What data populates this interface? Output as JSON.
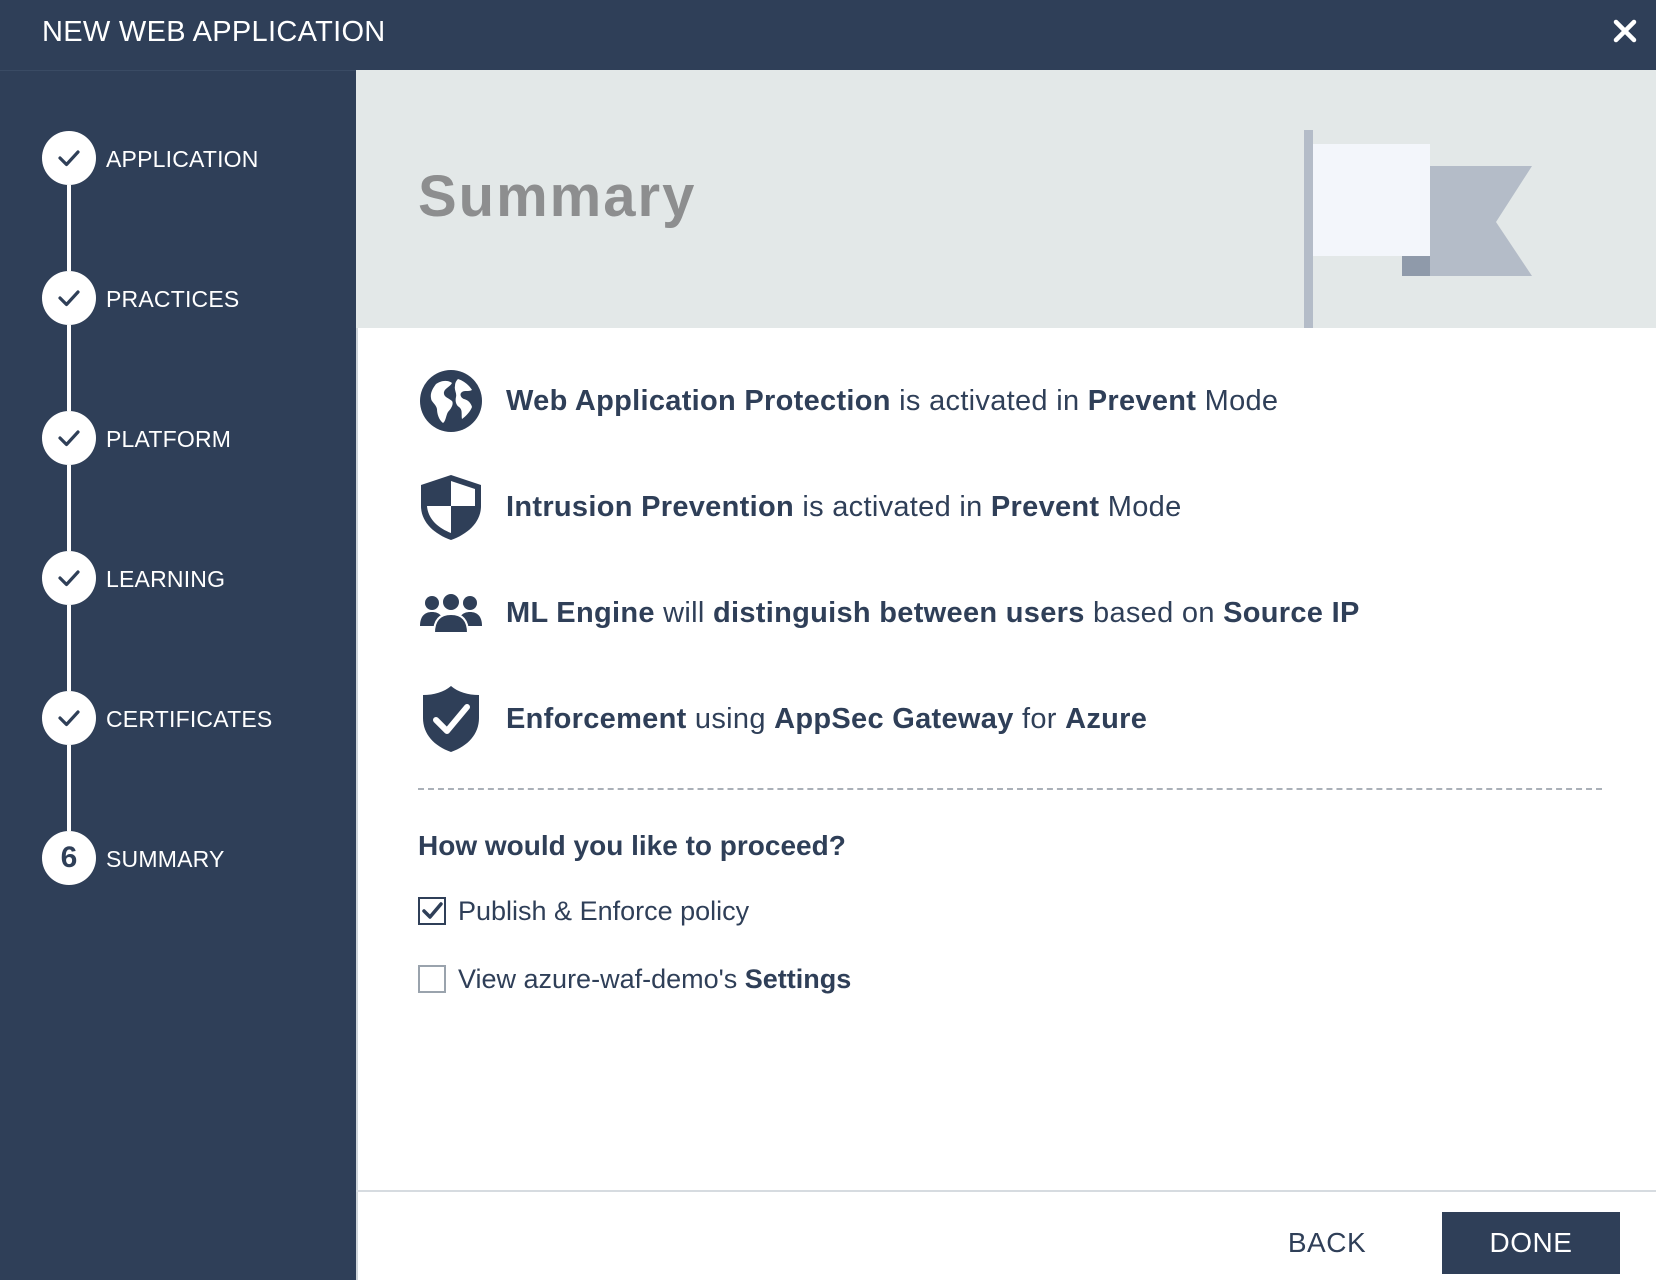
{
  "window": {
    "title": "NEW WEB APPLICATION",
    "close_icon": "close-icon"
  },
  "steps": [
    {
      "label": "APPLICATION",
      "state": "done",
      "icon": "check-icon"
    },
    {
      "label": "PRACTICES",
      "state": "done",
      "icon": "check-icon"
    },
    {
      "label": "PLATFORM",
      "state": "done",
      "icon": "check-icon"
    },
    {
      "label": "LEARNING",
      "state": "done",
      "icon": "check-icon"
    },
    {
      "label": "CERTIFICATES",
      "state": "done",
      "icon": "check-icon"
    },
    {
      "label": "SUMMARY",
      "state": "current",
      "number": "6"
    }
  ],
  "banner": {
    "title": "Summary",
    "icon": "flag-icon"
  },
  "summary_items": [
    {
      "icon": "globe-icon",
      "parts": [
        {
          "t": "Web Application Protection",
          "b": true
        },
        {
          "t": " is activated in "
        },
        {
          "t": "Prevent",
          "b": true
        },
        {
          "t": " Mode"
        }
      ]
    },
    {
      "icon": "shield-checkered-icon",
      "parts": [
        {
          "t": "Intrusion Prevention",
          "b": true
        },
        {
          "t": " is activated in "
        },
        {
          "t": "Prevent",
          "b": true
        },
        {
          "t": " Mode"
        }
      ]
    },
    {
      "icon": "users-icon",
      "parts": [
        {
          "t": "ML Engine",
          "b": true
        },
        {
          "t": " will "
        },
        {
          "t": "distinguish between users",
          "b": true
        },
        {
          "t": " based on "
        },
        {
          "t": "Source IP",
          "b": true
        }
      ]
    },
    {
      "icon": "shield-check-icon",
      "parts": [
        {
          "t": "Enforcement",
          "b": true
        },
        {
          "t": " using "
        },
        {
          "t": "AppSec Gateway",
          "b": true
        },
        {
          "t": " for "
        },
        {
          "t": "Azure",
          "b": true
        }
      ]
    }
  ],
  "proceed": {
    "question": "How would you like to proceed?",
    "options": [
      {
        "checked": true,
        "text": "Publish & Enforce policy",
        "bold": ""
      },
      {
        "checked": false,
        "text": "View azure-waf-demo's ",
        "bold": "Settings"
      }
    ]
  },
  "footer": {
    "back_label": "BACK",
    "done_label": "DONE"
  },
  "colors": {
    "navy": "#2f3f58",
    "banner_bg": "#e3e8e8",
    "banner_title": "#8d8e8f"
  }
}
